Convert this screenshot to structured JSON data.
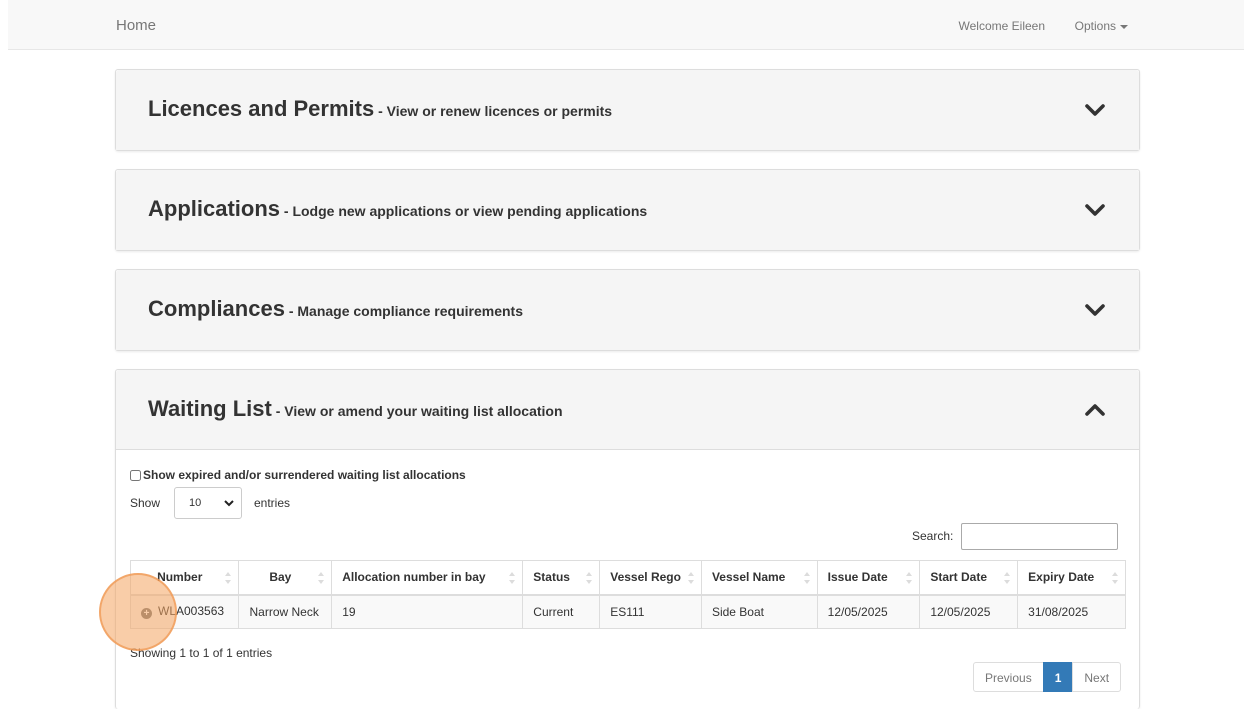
{
  "nav": {
    "brand": "Home",
    "welcome": "Welcome Eileen",
    "options": "Options"
  },
  "panels": [
    {
      "title": "Licences and Permits",
      "subtitle": " - View or renew licences or permits",
      "state": "collapsed"
    },
    {
      "title": "Applications",
      "subtitle": " - Lodge new applications or view pending applications",
      "state": "collapsed"
    },
    {
      "title": "Compliances",
      "subtitle": " - Manage compliance requirements",
      "state": "collapsed"
    },
    {
      "title": "Waiting List",
      "subtitle": " - View or amend your waiting list allocation",
      "state": "expanded"
    }
  ],
  "waiting_list": {
    "checkbox_label": "Show expired and/or surrendered waiting list allocations",
    "show_label": "Show",
    "entries_value": "10",
    "entries_label": "entries",
    "search_label": "Search:",
    "search_value": "",
    "columns": [
      "Number",
      "Bay",
      "Allocation number in bay",
      "Status",
      "Vessel Rego",
      "Vessel Name",
      "Issue Date",
      "Start Date",
      "Expiry Date"
    ],
    "rows": [
      [
        "WLA003563",
        "Narrow Neck",
        "19",
        "Current",
        "ES111",
        "Side Boat",
        "12/05/2025",
        "12/05/2025",
        "31/08/2025"
      ]
    ],
    "info": "Showing 1 to 1 of 1 entries",
    "pagination": {
      "previous": "Previous",
      "page": "1",
      "next": "Next"
    }
  },
  "icons": {
    "collapsed": "chevron-down-icon",
    "expanded": "chevron-up-icon",
    "row_expand": "plus-circle-icon"
  },
  "colors": {
    "accent": "#337ab7",
    "highlight": "#f4a460"
  }
}
